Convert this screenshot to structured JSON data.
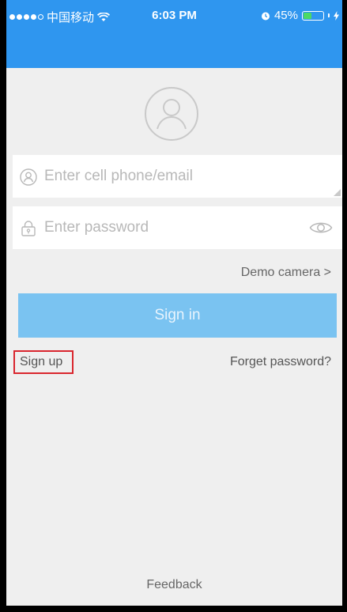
{
  "status_bar": {
    "carrier": "中国移动",
    "time": "6:03 PM",
    "battery_text": "45%",
    "battery_level": 0.45
  },
  "login": {
    "user_placeholder": "Enter cell phone/email",
    "password_placeholder": "Enter password",
    "demo_camera_label": "Demo camera >",
    "signin_label": "Sign in",
    "signup_label": "Sign up",
    "forget_password_label": "Forget password?",
    "feedback_label": "Feedback"
  },
  "colors": {
    "header_blue": "#2f96ef",
    "signin_button": "#7ac3f1",
    "highlight_red": "#d9262e",
    "background": "#efefef"
  },
  "icons": {
    "avatar": "user-avatar-icon",
    "user_field": "user-icon",
    "password_field": "lock-icon",
    "password_toggle": "eye-icon"
  }
}
